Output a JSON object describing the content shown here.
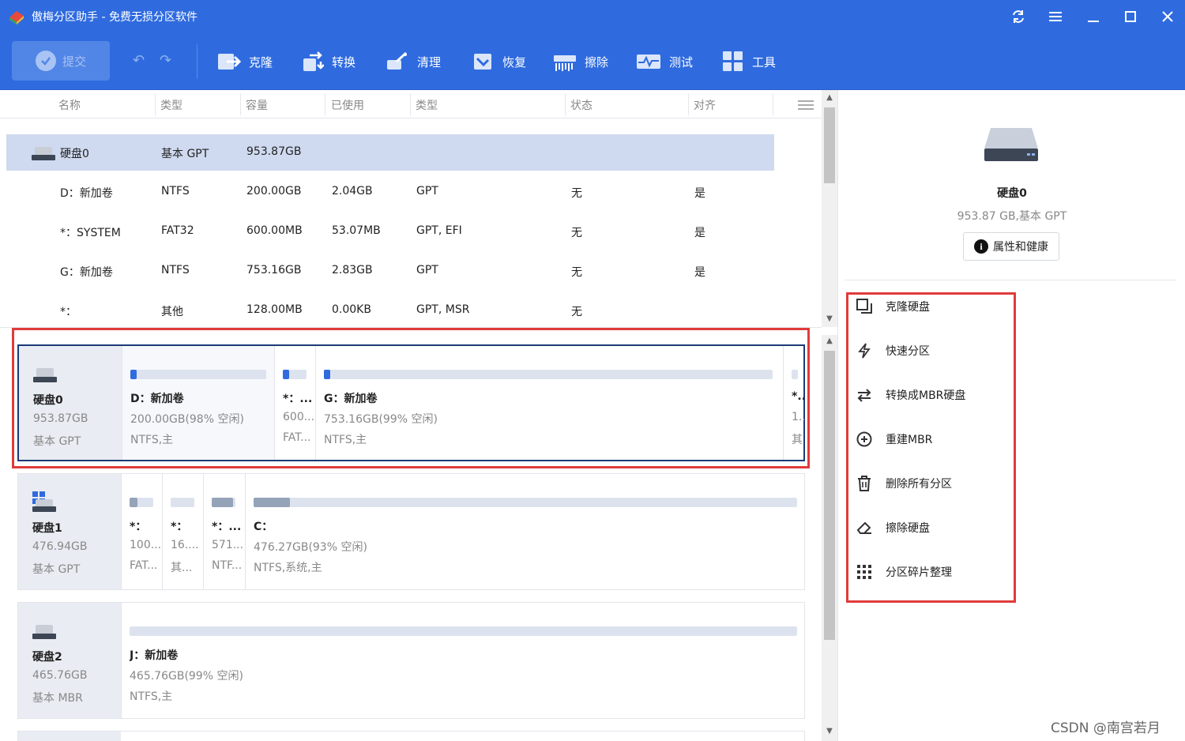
{
  "window": {
    "title": "傲梅分区助手 - 免费无损分区软件"
  },
  "toolbar": {
    "submit_label": "提交",
    "items": [
      "克隆",
      "转换",
      "清理",
      "恢复",
      "擦除",
      "测试",
      "工具"
    ]
  },
  "table": {
    "headers": [
      "名称",
      "类型",
      "容量",
      "已使用",
      "类型",
      "状态",
      "对齐"
    ],
    "disk_row": {
      "name": "硬盘0",
      "type": "基本 GPT",
      "capacity": "953.87GB"
    },
    "rows": [
      {
        "name": "D：新加卷",
        "fs": "NTFS",
        "capacity": "200.00GB",
        "used": "2.04GB",
        "ptype": "GPT",
        "status": "无",
        "align": "是"
      },
      {
        "name": "*：SYSTEM",
        "fs": "FAT32",
        "capacity": "600.00MB",
        "used": "53.07MB",
        "ptype": "GPT, EFI",
        "status": "无",
        "align": "是"
      },
      {
        "name": "G：新加卷",
        "fs": "NTFS",
        "capacity": "753.16GB",
        "used": "2.83GB",
        "ptype": "GPT",
        "status": "无",
        "align": "是"
      },
      {
        "name": "*：",
        "fs": "其他",
        "capacity": "128.00MB",
        "used": "0.00KB",
        "ptype": "GPT, MSR",
        "status": "无",
        "align": ""
      }
    ]
  },
  "disks": [
    {
      "name": "硬盘0",
      "size": "953.87GB",
      "type": "基本 GPT",
      "partitions": [
        {
          "name": "D：新加卷",
          "free": "200.00GB(98% 空闲)",
          "fs": "NTFS,主",
          "used_fraction": 0.02
        },
        {
          "name": "*：...",
          "free": "600...",
          "fs": "FAT...",
          "used_fraction": 0.09
        },
        {
          "name": "G：新加卷",
          "free": "753.16GB(99% 空闲)",
          "fs": "NTFS,主",
          "used_fraction": 0.01
        },
        {
          "name": "*..",
          "free": "1..",
          "fs": "其",
          "used_fraction": 0.0
        }
      ]
    },
    {
      "name": "硬盘1",
      "size": "476.94GB",
      "type": "基本 GPT",
      "partitions": [
        {
          "name": "*：",
          "free": "100...",
          "fs": "FAT...",
          "used_fraction": 0.3
        },
        {
          "name": "*：",
          "free": "16....",
          "fs": "其...",
          "used_fraction": 0.0
        },
        {
          "name": "*：...",
          "free": "571...",
          "fs": "NTF...",
          "used_fraction": 0.9
        },
        {
          "name": "C：",
          "free": "476.27GB(93% 空闲)",
          "fs": "NTFS,系统,主",
          "used_fraction": 0.07
        }
      ]
    },
    {
      "name": "硬盘2",
      "size": "465.76GB",
      "type": "基本 MBR",
      "partitions": [
        {
          "name": "J：新加卷",
          "free": "465.76GB(99% 空闲)",
          "fs": "NTFS,主",
          "used_fraction": 0.0
        }
      ]
    }
  ],
  "right_panel": {
    "disk_name": "硬盘0",
    "disk_sub": "953.87 GB,基本 GPT",
    "props_button": "属性和健康",
    "actions": [
      "克隆硬盘",
      "快速分区",
      "转换成MBR硬盘",
      "重建MBR",
      "删除所有分区",
      "擦除硬盘",
      "分区碎片整理"
    ]
  },
  "watermark": "CSDN @南宫若月"
}
